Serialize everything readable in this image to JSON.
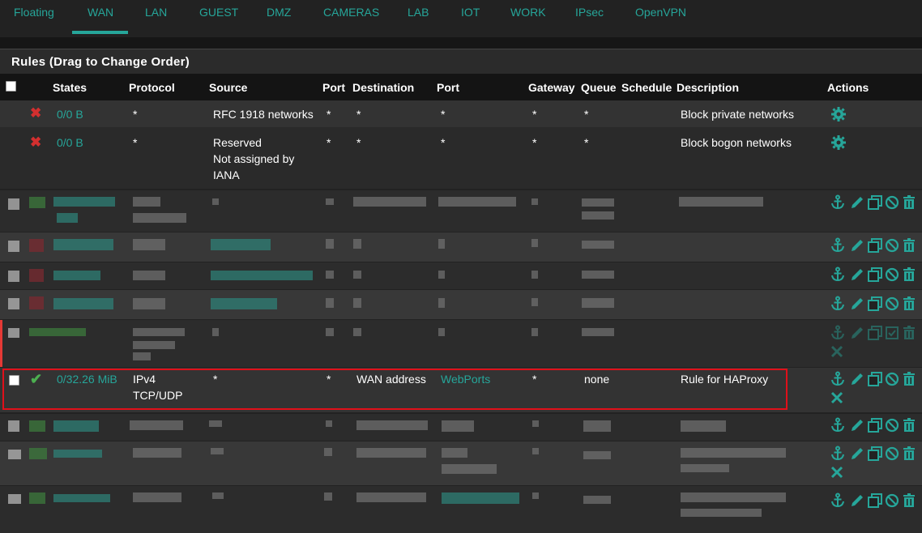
{
  "tabs": [
    "Floating",
    "WAN",
    "LAN",
    "GUEST",
    "DMZ",
    "CAMERAS",
    "LAB",
    "IOT",
    "WORK",
    "IPsec",
    "OpenVPN"
  ],
  "active_tab": "WAN",
  "panel_title": "Rules (Drag to Change Order)",
  "columns": {
    "states": "States",
    "protocol": "Protocol",
    "source": "Source",
    "port": "Port",
    "destination": "Destination",
    "dport": "Port",
    "gateway": "Gateway",
    "queue": "Queue",
    "schedule": "Schedule",
    "description": "Description",
    "actions": "Actions"
  },
  "rules": [
    {
      "states": "0/0 B",
      "protocol": "*",
      "source": "RFC 1918 networks",
      "port": "*",
      "destination": "*",
      "dport": "*",
      "gateway": "*",
      "queue": "*",
      "schedule": "",
      "description": "Block private networks",
      "icon": "x-icon"
    },
    {
      "states": "0/0 B",
      "protocol": "*",
      "source_lines": [
        "Reserved",
        "Not assigned by",
        "IANA"
      ],
      "port": "*",
      "destination": "*",
      "dport": "*",
      "gateway": "*",
      "queue": "*",
      "schedule": "",
      "description": "Block bogon networks",
      "icon": "x-icon"
    }
  ],
  "highlighted_rule": {
    "states": "0/32.26 MiB",
    "protocol_lines": [
      "IPv4",
      "TCP/UDP"
    ],
    "source": "*",
    "port": "*",
    "destination": "WAN address",
    "dport": "WebPorts",
    "gateway": "*",
    "queue": "none",
    "schedule": "",
    "description": "Rule for HAProxy",
    "icon": "check-icon"
  },
  "colors": {
    "accent": "#26a69a",
    "block": "#d32f2f",
    "pass": "#4caf50",
    "highlight_border": "#e0101a",
    "background": "#222222"
  }
}
